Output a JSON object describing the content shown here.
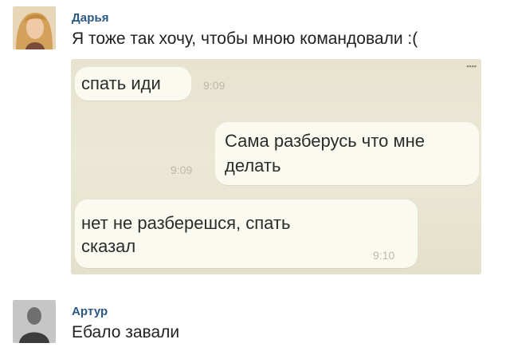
{
  "comments": [
    {
      "author": "Дарья",
      "text": "Я тоже так хочу, чтобы мною командовали :("
    },
    {
      "author": "Артур",
      "text": "Ебало завали"
    }
  ],
  "attachment": {
    "messages": [
      {
        "side": "left",
        "text": "спать иди",
        "time": "9:09"
      },
      {
        "side": "right",
        "line1": "Сама разберусь что мне",
        "line2": "делать",
        "time": "9:09"
      },
      {
        "side": "left",
        "line1": "нет не разберешся, спать",
        "line2": "сказал",
        "time": "9:10"
      }
    ]
  }
}
